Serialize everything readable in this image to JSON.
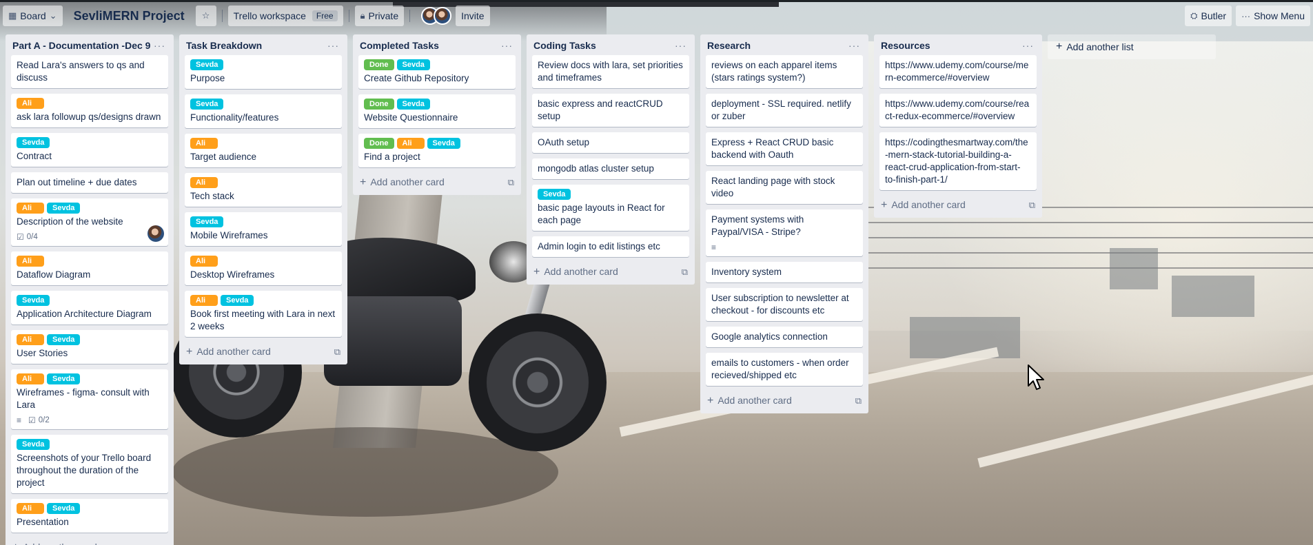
{
  "header": {
    "board_view_label": "Board",
    "board_title": "SevliMERN Project",
    "workspace_label": "Trello workspace",
    "workspace_badge": "Free",
    "visibility_label": "Private",
    "invite_label": "Invite",
    "butler_label": "Butler",
    "show_menu_label": "Show Menu"
  },
  "icons": {
    "board_view": "board-icon",
    "star": "star-icon",
    "private": "lock-icon",
    "butler": "butler-icon",
    "menu": "more-dots-icon",
    "checklist": "checklist-icon",
    "description": "description-icon",
    "template": "card-template-icon",
    "add": "plus-icon"
  },
  "label_colors": {
    "Ali": "#ff9f1a",
    "Sevda": "#00c2e0",
    "Done": "#61bd4f"
  },
  "add_card_label": "Add another card",
  "add_list_label": "Add another list",
  "lists": [
    {
      "title": "Part A - Documentation -Dec 9",
      "cards": [
        {
          "labels": [],
          "title": "Read Lara's answers to qs and discuss"
        },
        {
          "labels": [
            "Ali"
          ],
          "title": "ask lara followup qs/designs drawn"
        },
        {
          "labels": [
            "Sevda"
          ],
          "title": "Contract"
        },
        {
          "labels": [],
          "title": "Plan out timeline + due dates"
        },
        {
          "labels": [
            "Ali",
            "Sevda"
          ],
          "title": "Description of the website",
          "checklist": "0/4",
          "avatar": true
        },
        {
          "labels": [
            "Ali"
          ],
          "title": "Dataflow Diagram"
        },
        {
          "labels": [
            "Sevda"
          ],
          "title": "Application Architecture Diagram"
        },
        {
          "labels": [
            "Ali",
            "Sevda"
          ],
          "title": "User Stories"
        },
        {
          "labels": [
            "Ali",
            "Sevda"
          ],
          "title": "Wireframes - figma- consult with Lara",
          "description": true,
          "checklist": "0/2"
        },
        {
          "labels": [
            "Sevda"
          ],
          "title": "Screenshots of your Trello board throughout the duration of the project"
        },
        {
          "labels": [
            "Ali",
            "Sevda"
          ],
          "title": "Presentation"
        }
      ]
    },
    {
      "title": "Task Breakdown",
      "cards": [
        {
          "labels": [
            "Sevda"
          ],
          "title": "Purpose"
        },
        {
          "labels": [
            "Sevda"
          ],
          "title": "Functionality/features"
        },
        {
          "labels": [
            "Ali"
          ],
          "title": "Target audience"
        },
        {
          "labels": [
            "Ali"
          ],
          "title": "Tech stack"
        },
        {
          "labels": [
            "Sevda"
          ],
          "title": "Mobile Wireframes"
        },
        {
          "labels": [
            "Ali"
          ],
          "title": "Desktop Wireframes"
        },
        {
          "labels": [
            "Ali",
            "Sevda"
          ],
          "title": "Book first meeting with Lara in next 2 weeks"
        }
      ]
    },
    {
      "title": "Completed Tasks",
      "cards": [
        {
          "labels": [
            "Done",
            "Sevda"
          ],
          "title": "Create Github Repository"
        },
        {
          "labels": [
            "Done",
            "Sevda"
          ],
          "title": "Website Questionnaire"
        },
        {
          "labels": [
            "Done",
            "Ali",
            "Sevda"
          ],
          "title": "Find a project"
        }
      ]
    },
    {
      "title": "Coding Tasks",
      "cards": [
        {
          "labels": [],
          "title": "Review docs with lara, set priorities and timeframes"
        },
        {
          "labels": [],
          "title": "basic express and reactCRUD setup"
        },
        {
          "labels": [],
          "title": "OAuth setup"
        },
        {
          "labels": [],
          "title": "mongodb atlas cluster setup"
        },
        {
          "labels": [
            "Sevda"
          ],
          "title": "basic page layouts in React for each page"
        },
        {
          "labels": [],
          "title": "Admin login to edit listings etc"
        }
      ]
    },
    {
      "title": "Research",
      "cards": [
        {
          "labels": [],
          "title": "reviews on each apparel items (stars ratings system?)"
        },
        {
          "labels": [],
          "title": "deployment - SSL required. netlify or zuber"
        },
        {
          "labels": [],
          "title": "Express + React CRUD basic backend with Oauth"
        },
        {
          "labels": [],
          "title": "React landing page with stock video"
        },
        {
          "labels": [],
          "title": "Payment systems with Paypal/VISA - Stripe?",
          "description": true
        },
        {
          "labels": [],
          "title": "Inventory system"
        },
        {
          "labels": [],
          "title": "User subscription to newsletter at checkout - for discounts etc"
        },
        {
          "labels": [],
          "title": "Google analytics connection"
        },
        {
          "labels": [],
          "title": "emails to customers - when order recieved/shipped etc"
        }
      ]
    },
    {
      "title": "Resources",
      "cards": [
        {
          "labels": [],
          "title": "https://www.udemy.com/course/mern-ecommerce/#overview"
        },
        {
          "labels": [],
          "title": "https://www.udemy.com/course/react-redux-ecommerce/#overview"
        },
        {
          "labels": [],
          "title": "https://codingthesmartway.com/the-mern-stack-tutorial-building-a-react-crud-application-from-start-to-finish-part-1/"
        }
      ]
    }
  ]
}
